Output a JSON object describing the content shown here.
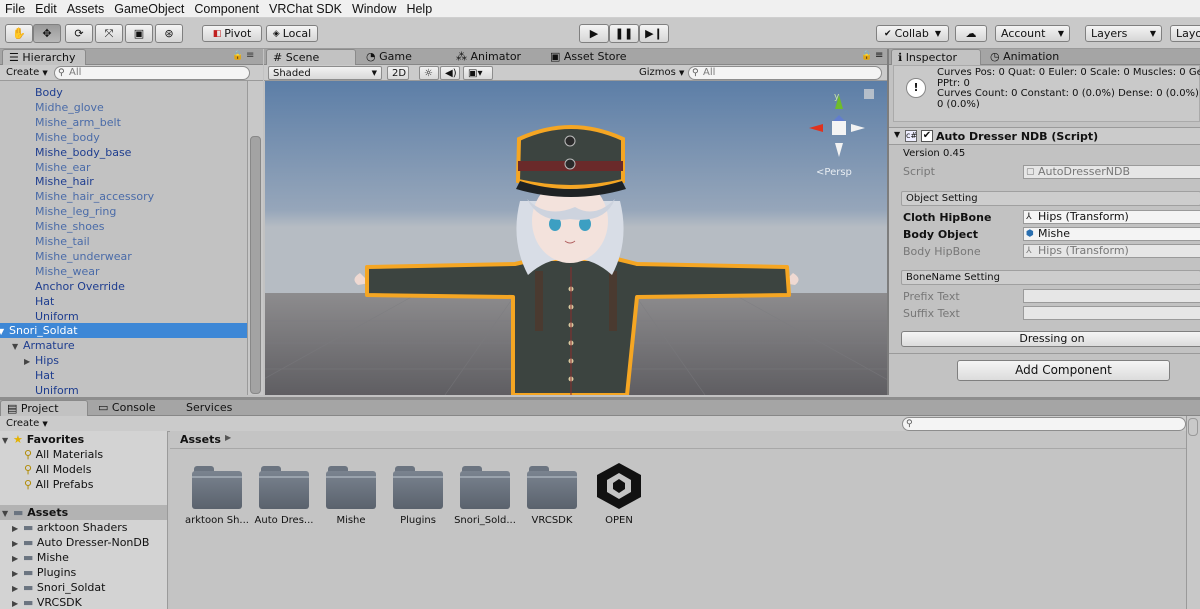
{
  "menu": [
    "File",
    "Edit",
    "Assets",
    "GameObject",
    "Component",
    "VRChat SDK",
    "Window",
    "Help"
  ],
  "toolbar": {
    "pivot": "Pivot",
    "local": "Local",
    "collab": "Collab",
    "account": "Account",
    "layers": "Layers",
    "layout": "Layo"
  },
  "hierarchy": {
    "tab": "Hierarchy",
    "create": "Create",
    "search_placeholder": "All",
    "rows": [
      {
        "label": "Body",
        "indent": 36,
        "style": "blue"
      },
      {
        "label": "Midhe_glove",
        "indent": 36,
        "style": "pale"
      },
      {
        "label": "Mishe_arm_belt",
        "indent": 36,
        "style": "pale"
      },
      {
        "label": "Mishe_body",
        "indent": 36,
        "style": "pale"
      },
      {
        "label": "Mishe_body_base",
        "indent": 36,
        "style": "blue"
      },
      {
        "label": "Mishe_ear",
        "indent": 36,
        "style": "pale"
      },
      {
        "label": "Mishe_hair",
        "indent": 36,
        "style": "blue"
      },
      {
        "label": "Mishe_hair_accessory",
        "indent": 36,
        "style": "pale"
      },
      {
        "label": "Mishe_leg_ring",
        "indent": 36,
        "style": "pale"
      },
      {
        "label": "Mishe_shoes",
        "indent": 36,
        "style": "pale"
      },
      {
        "label": "Mishe_tail",
        "indent": 36,
        "style": "pale"
      },
      {
        "label": "Mishe_underwear",
        "indent": 36,
        "style": "pale"
      },
      {
        "label": "Mishe_wear",
        "indent": 36,
        "style": "pale"
      },
      {
        "label": "Anchor Override",
        "indent": 36,
        "style": "blue"
      },
      {
        "label": "Hat",
        "indent": 36,
        "style": "blue"
      },
      {
        "label": "Uniform",
        "indent": 36,
        "style": "blue"
      },
      {
        "label": "Snori_Soldat",
        "indent": 10,
        "style": "sel",
        "arrow": "▼"
      },
      {
        "label": "Armature",
        "indent": 24,
        "style": "blue",
        "arrow": "▼"
      },
      {
        "label": "Hips",
        "indent": 36,
        "style": "blue",
        "arrow": "▶"
      },
      {
        "label": "Hat",
        "indent": 36,
        "style": "blue"
      },
      {
        "label": "Uniform",
        "indent": 36,
        "style": "blue"
      }
    ]
  },
  "scene": {
    "tabs": [
      "Scene",
      "Game",
      "Animator",
      "Asset Store"
    ],
    "shading": "Shaded",
    "mode2d": "2D",
    "gizmos": "Gizmos",
    "search_placeholder": "All",
    "persp": "Persp",
    "gizmo_y": "y"
  },
  "inspector": {
    "tabs": [
      "Inspector",
      "Animation"
    ],
    "curves_line1": "Curves Pos: 0 Quat: 0 Euler: 0 Scale: 0 Muscles: 0 Gen",
    "curves_line2": "PPtr: 0",
    "curves_line3": "Curves Count: 0 Constant: 0 (0.0%) Dense: 0 (0.0%) St",
    "curves_line4": "0 (0.0%)",
    "component_title": "Auto Dresser NDB (Script)",
    "version": "Version 0.45",
    "script_label": "Script",
    "script_value": "AutoDresserNDB",
    "object_setting": "Object Setting",
    "cloth_hipbone_label": "Cloth HipBone",
    "cloth_hipbone_value": "Hips (Transform)",
    "body_object_label": "Body Object",
    "body_object_value": "Mishe",
    "body_hipbone_label": "Body HipBone",
    "body_hipbone_value": "Hips (Transform)",
    "bonename_setting": "BoneName Setting",
    "prefix_label": "Prefix Text",
    "suffix_label": "Suffix Text",
    "dressing_button": "Dressing on",
    "add_component": "Add Component"
  },
  "project": {
    "tabs": [
      "Project",
      "Console",
      "Services"
    ],
    "create": "Create",
    "breadcrumb": "Assets",
    "favorites": "Favorites",
    "fav_items": [
      "All Materials",
      "All Models",
      "All Prefabs"
    ],
    "assets_root": "Assets",
    "tree": [
      "arktoon Shaders",
      "Auto Dresser-NonDB",
      "Mishe",
      "Plugins",
      "Snori_Soldat",
      "VRCSDK"
    ],
    "grid": [
      "arktoon Sh...",
      "Auto Dres...",
      "Mishe",
      "Plugins",
      "Snori_Sold...",
      "VRCSDK",
      "OPEN"
    ]
  },
  "colors": {
    "selection": "#3d87d6",
    "outline": "#f5a623",
    "sky_top": "#5e7fa6",
    "ground": "#6f6f72"
  }
}
